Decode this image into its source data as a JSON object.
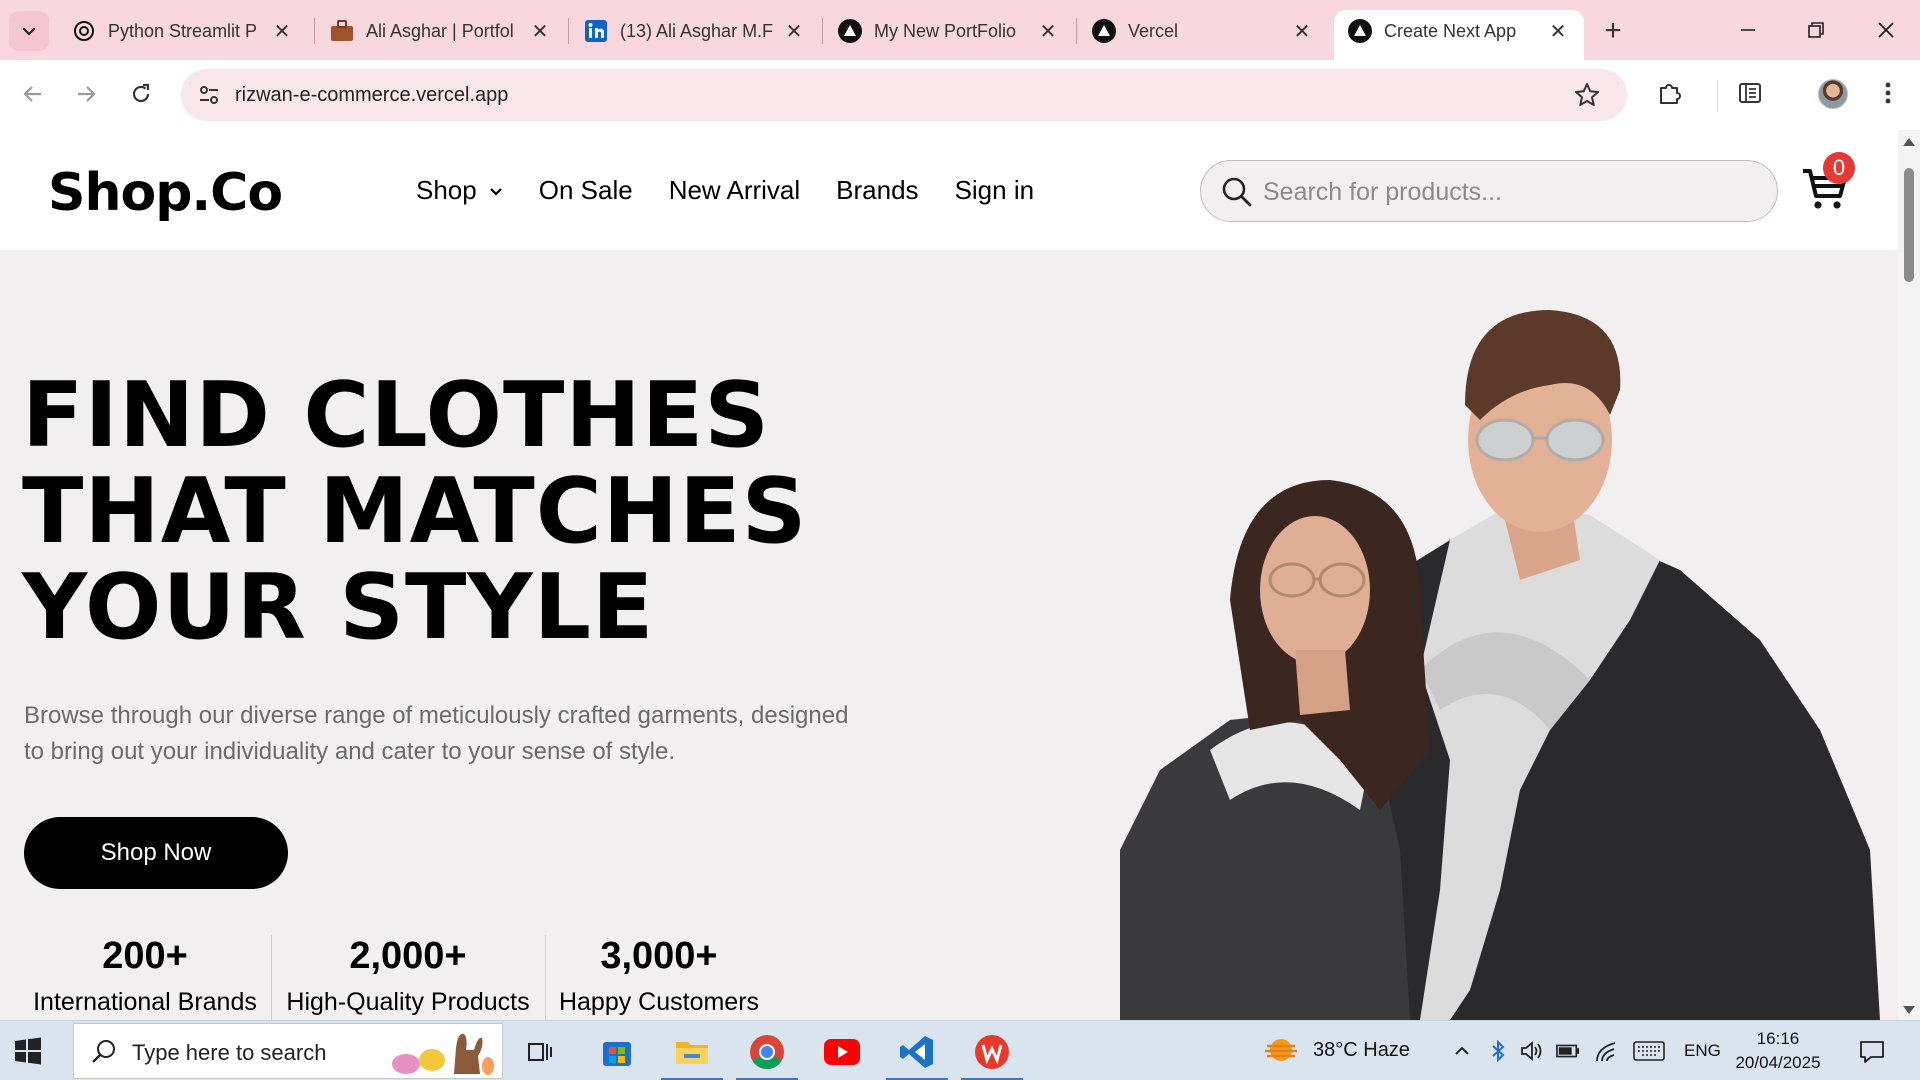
{
  "browser": {
    "tabs": [
      {
        "title": "Python Streamlit P",
        "icon": "openai-icon"
      },
      {
        "title": "Ali Asghar | Portfol",
        "icon": "briefcase-icon"
      },
      {
        "title": "(13) Ali Asghar M.F",
        "icon": "linkedin-icon"
      },
      {
        "title": "My New PortFolio",
        "icon": "vercel-icon"
      },
      {
        "title": "Vercel",
        "icon": "vercel-icon"
      },
      {
        "title": "Create Next App",
        "icon": "vercel-icon",
        "active": true
      }
    ],
    "new_tab": "+",
    "url": "rizwan-e-commerce.vercel.app"
  },
  "site": {
    "logo": "Shop.Co",
    "nav": [
      "Shop",
      "On Sale",
      "New Arrival",
      "Brands",
      "Sign in"
    ],
    "search_placeholder": "Search for products...",
    "cart_count": "0",
    "hero": {
      "title_lines": [
        "FIND CLOTHES",
        "THAT MATCHES",
        "YOUR STYLE"
      ],
      "description": "Browse through our diverse range of meticulously crafted garments, designed to bring out your individuality and cater to your sense of style.",
      "cta": "Shop Now"
    },
    "stats": [
      {
        "value": "200+",
        "label": "International Brands"
      },
      {
        "value": "2,000+",
        "label": "High-Quality Products"
      },
      {
        "value": "3,000+",
        "label": "Happy Customers"
      }
    ]
  },
  "taskbar": {
    "search_placeholder": "Type here to search",
    "weather": "38°C  Haze",
    "language": "ENG",
    "time": "16:16",
    "date": "20/04/2025"
  },
  "colors": {
    "tabstrip": "#f9d7df",
    "omnibox": "#f8e6ea",
    "page_bg": "#f1eff0",
    "badge": "#e53935",
    "cta_bg": "#000000"
  }
}
